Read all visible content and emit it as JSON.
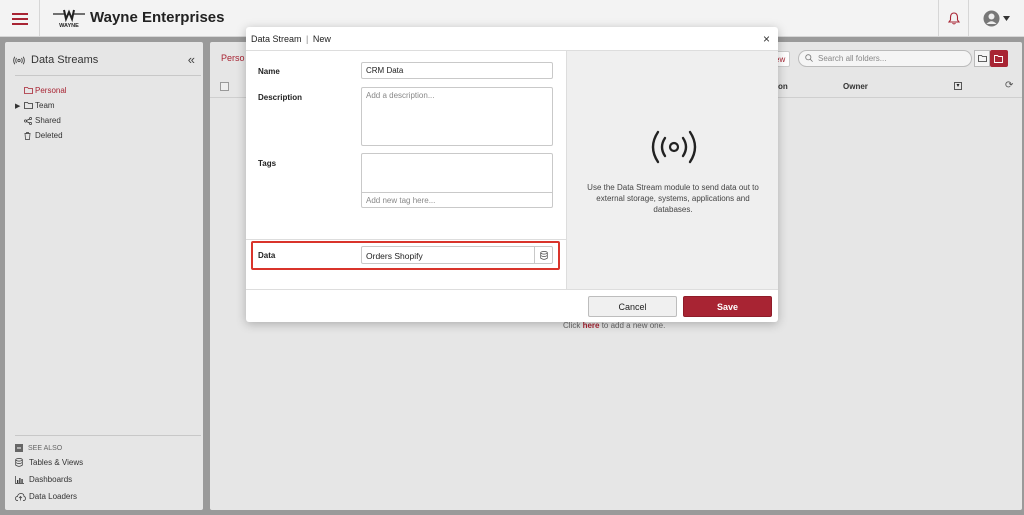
{
  "app": {
    "brand": "Wayne Enterprises",
    "logo_text": "WAYNE",
    "icons": {
      "menu": "hamburger-menu-icon",
      "bell": "bell-icon",
      "user": "user-avatar-icon"
    },
    "accent": "#a82433"
  },
  "sidebar": {
    "title": "Data Streams",
    "collapse_label": "«",
    "items": [
      {
        "label": "Personal",
        "icon": "folder-icon",
        "active": true
      },
      {
        "label": "Team",
        "icon": "folder-icon",
        "expandable": true
      },
      {
        "label": "Shared",
        "icon": "share-icon"
      },
      {
        "label": "Deleted",
        "icon": "trash-icon"
      }
    ],
    "see_also": {
      "header": "SEE ALSO",
      "links": [
        {
          "label": "Tables & Views",
          "icon": "database-icon"
        },
        {
          "label": "Dashboards",
          "icon": "bar-chart-icon"
        },
        {
          "label": "Data Loaders",
          "icon": "cloud-upload-icon"
        }
      ]
    }
  },
  "main": {
    "breadcrumb": "Perso",
    "new_button": "ew",
    "search": {
      "placeholder": "Search all folders..."
    },
    "columns": {
      "on": "on",
      "owner": "Owner"
    },
    "empty": {
      "prefix": "Click ",
      "link": "here",
      "suffix": " to add a new one."
    }
  },
  "modal": {
    "title": "Data Stream",
    "separator": "|",
    "subtitle": "New",
    "close_label": "×",
    "fields": {
      "name": {
        "label": "Name",
        "value": "CRM Data"
      },
      "description": {
        "label": "Description",
        "placeholder": "Add a description..."
      },
      "tags": {
        "label": "Tags",
        "placeholder": "Add new tag here..."
      },
      "data": {
        "label": "Data",
        "value": "Orders Shopify"
      }
    },
    "info_text": "Use the Data Stream module to send data out to external storage, systems, applications and databases.",
    "buttons": {
      "cancel": "Cancel",
      "save": "Save"
    }
  }
}
